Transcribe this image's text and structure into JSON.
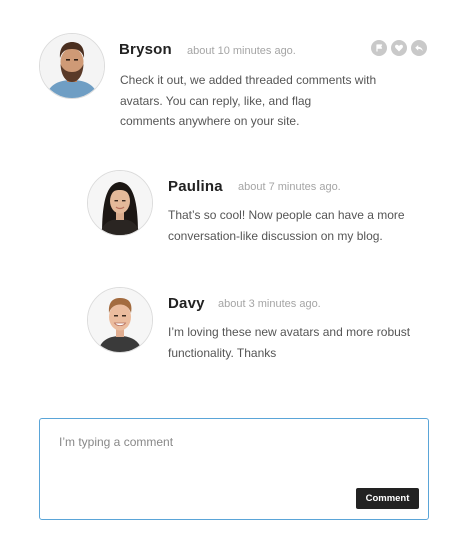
{
  "comments": [
    {
      "author": "Bryson",
      "time": "about 10 minutes ago.",
      "lines": [
        "Check it out, we added threaded comments with",
        "avatars. You can reply, like, and flag",
        "comments anywhere on your site."
      ]
    },
    {
      "author": "Paulina",
      "time": "about 7 minutes ago.",
      "lines": [
        "That’s so cool! Now people can have a more",
        "conversation-like discussion on my blog."
      ]
    },
    {
      "author": "Davy",
      "time": "about 3 minutes ago.",
      "lines": [
        "I’m loving these new avatars and more robust",
        "functionality. Thanks"
      ]
    }
  ],
  "actions": {
    "icons": [
      "flag-icon",
      "heart-icon",
      "reply-icon"
    ]
  },
  "composer": {
    "placeholder": "I’m typing a comment",
    "submit_label": "Comment"
  },
  "colors": {
    "composer_border": "#5aa5d8",
    "action_icon_bg": "#c9c9c9",
    "button_bg": "#222222"
  }
}
